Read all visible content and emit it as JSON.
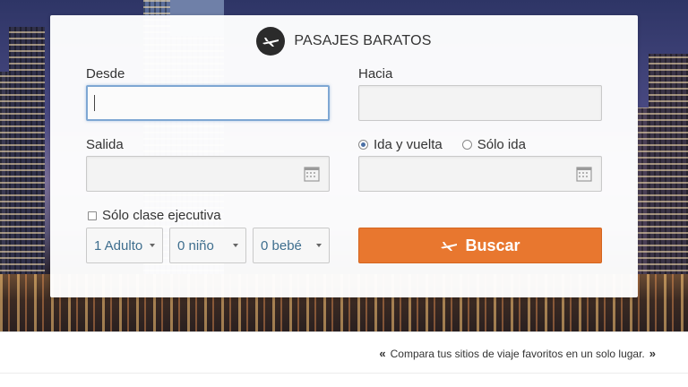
{
  "header": {
    "title": "PASAJES BARATOS",
    "icon": "airplane-icon"
  },
  "form": {
    "from": {
      "label": "Desde",
      "value": "",
      "placeholder": ""
    },
    "to": {
      "label": "Hacia",
      "value": "",
      "placeholder": ""
    },
    "departure": {
      "label": "Salida",
      "value": "",
      "icon": "calendar-icon"
    },
    "return": {
      "value": "",
      "icon": "calendar-icon"
    },
    "trip_type": {
      "options": [
        "Ida y vuelta",
        "Sólo ida"
      ],
      "selected": "Ida y vuelta"
    },
    "business_only": {
      "label": "Sólo clase ejecutiva",
      "checked": false
    },
    "passengers": {
      "adults": "1 Adulto",
      "children": "0 niño",
      "infants": "0 bebé"
    },
    "search_button": {
      "label": "Buscar",
      "color": "#e8772f"
    }
  },
  "footer": {
    "tagline": "Compara tus sitios de viaje favoritos en un solo lugar.",
    "open_quote": "«",
    "close_quote": "»"
  },
  "colors": {
    "accent": "#e8772f",
    "focus": "#7ea7d3",
    "select_text": "#3e6e8e"
  }
}
